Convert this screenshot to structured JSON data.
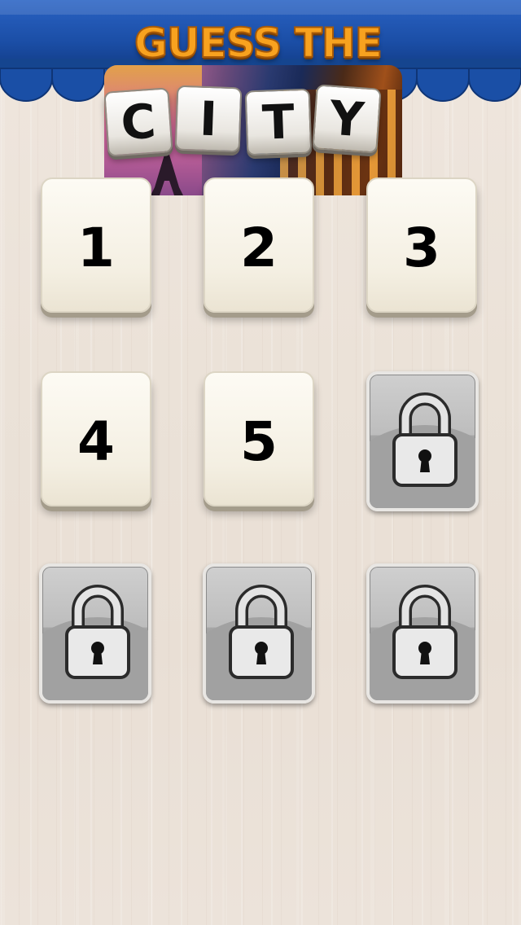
{
  "title": {
    "line1": "GUESS THE",
    "letters": [
      "C",
      "I",
      "T",
      "Y"
    ]
  },
  "levels": [
    {
      "label": "1",
      "locked": false
    },
    {
      "label": "2",
      "locked": false
    },
    {
      "label": "3",
      "locked": false
    },
    {
      "label": "4",
      "locked": false
    },
    {
      "label": "5",
      "locked": false
    },
    {
      "label": "",
      "locked": true
    },
    {
      "label": "",
      "locked": true
    },
    {
      "label": "",
      "locked": true
    },
    {
      "label": "",
      "locked": true
    }
  ],
  "colors": {
    "awning": "#1f56b3",
    "title_orange": "#f8a21f",
    "background": "#ece3da",
    "locked_gray": "#b4b4b4"
  },
  "icons": {
    "locked_level": "padlock-icon"
  }
}
